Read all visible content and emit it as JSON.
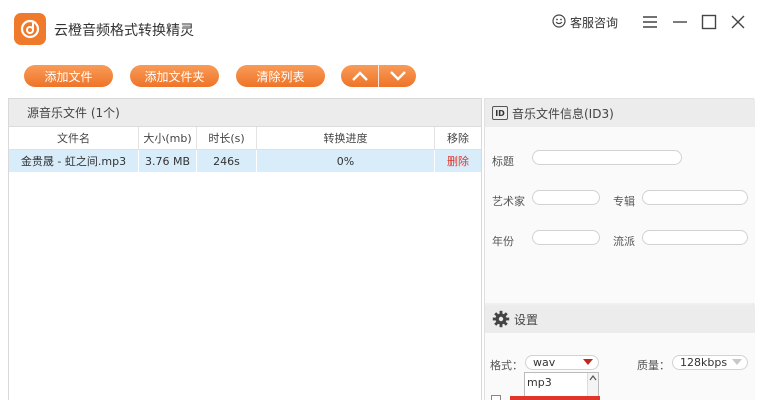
{
  "app": {
    "title": "云橙音频格式转换精灵",
    "support_label": "客服咨询"
  },
  "toolbar": {
    "add_file": "添加文件",
    "add_folder": "添加文件夹",
    "clear_list": "清除列表"
  },
  "source_panel": {
    "title": "源音乐文件 (1个)",
    "columns": [
      "文件名",
      "大小(mb)",
      "时长(s)",
      "转换进度",
      "移除"
    ],
    "rows": [
      {
        "name": "金贵晟 - 虹之间.mp3",
        "size": "3.76 MB",
        "duration": "246s",
        "progress": "0%",
        "remove": "删除"
      }
    ]
  },
  "id3_panel": {
    "title": "音乐文件信息(ID3)",
    "badge": "ID",
    "fields": {
      "title_label": "标题",
      "artist_label": "艺术家",
      "album_label": "专辑",
      "year_label": "年份",
      "genre_label": "流派"
    }
  },
  "settings_panel": {
    "title": "设置",
    "format_label": "格式：",
    "format_value": "wav",
    "quality_label": "质量：",
    "quality_value": "128kbps",
    "dropdown_options": [
      "mp3"
    ]
  },
  "colors": {
    "accent": "#ee7428",
    "delete": "#e0352b",
    "row_selected": "#d8ecfa",
    "format_caret": "#c0281e"
  }
}
